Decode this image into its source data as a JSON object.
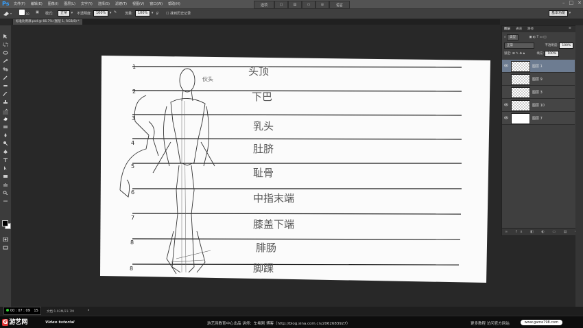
{
  "app": {
    "logo": "Ps",
    "menu": [
      "文件(F)",
      "编辑(E)",
      "图像(I)",
      "图层(L)",
      "文字(Y)",
      "选择(S)",
      "滤镜(T)",
      "视图(V)",
      "窗口(W)",
      "帮助(H)"
    ],
    "window_buttons": [
      "选项",
      "",
      "",
      "",
      "",
      "语言"
    ],
    "window_controls": [
      "–",
      "□",
      "×"
    ]
  },
  "options_bar": {
    "mode_label": "模式:",
    "mode_value": "正常",
    "opacity_label": "不透明度:",
    "opacity_value": "100%",
    "flow_label": "流量:",
    "flow_value": "100%",
    "history_label": "抹到历史记录",
    "workspace": "基本功能",
    "brush_size": "10"
  },
  "document_tab": "标准比例源.psd @ 66.7% (图层 1, RGB/8) *",
  "canvas": {
    "line_numbers": [
      "1",
      "2",
      "3",
      "4",
      "5",
      "6",
      "7",
      "8",
      "8"
    ],
    "chinese_labels": [
      "头顶",
      "下巴",
      "乳头",
      "肚脐",
      "耻骨",
      "中指末端",
      "膝盖下端",
      "腓肠",
      "脚踝"
    ],
    "margin_note": "伙头"
  },
  "layers_panel": {
    "tabs": [
      "图层",
      "通道",
      "路径"
    ],
    "kind_label": "类型",
    "blend_mode": "正常",
    "opacity_label": "不透明度:",
    "opacity_value": "100%",
    "lock_label": "锁定:",
    "fill_label": "填充:",
    "fill_value": "100%",
    "layers": [
      {
        "name": "图层 1",
        "selected": true,
        "visible": true,
        "thumb": "transparent"
      },
      {
        "name": "图层 9",
        "selected": false,
        "visible": false,
        "thumb": "transparent"
      },
      {
        "name": "图层 3",
        "selected": false,
        "visible": false,
        "thumb": "transparent"
      },
      {
        "name": "图层 10",
        "selected": false,
        "visible": true,
        "thumb": "transparent"
      },
      {
        "name": "图层 7",
        "selected": false,
        "visible": true,
        "thumb": "white"
      }
    ]
  },
  "status": {
    "doc_info": "文档:1.93M/23.7M",
    "recorder_time": "00 : 07 : 09",
    "recorder_count": "15"
  },
  "footer": {
    "brand": "游艺网",
    "video_label": "Video tutorial",
    "credit": "游艺网教育中心出品  讲师：车希刚  博客（http://blog.sina.com.cn/2062683927）",
    "more": "更多教程 访问官方网站",
    "site": "www.game798.com"
  }
}
